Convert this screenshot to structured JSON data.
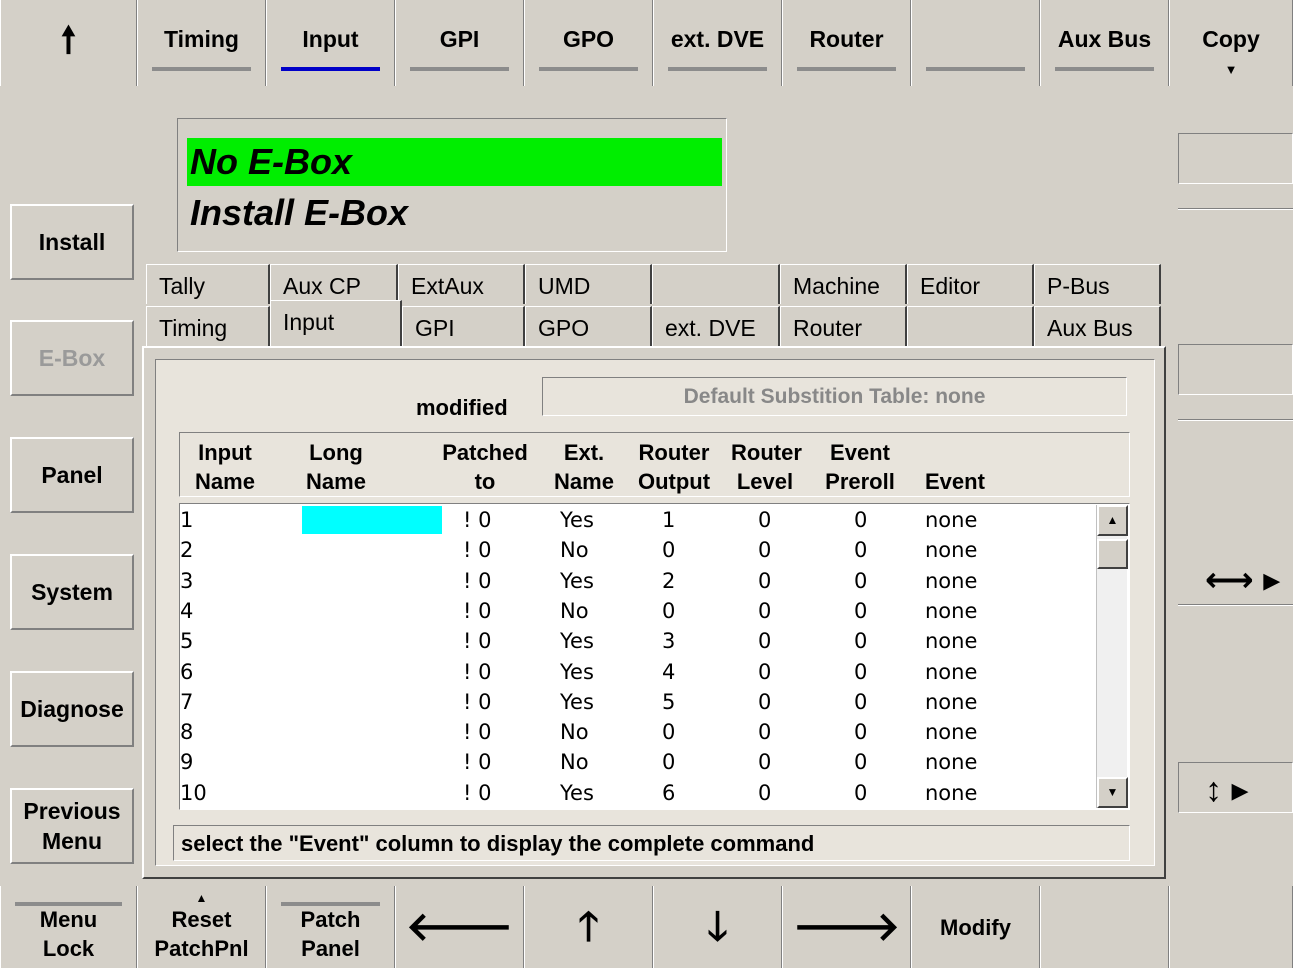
{
  "top_nav": {
    "up_icon": "up-arrow",
    "items": [
      {
        "label": "Timing",
        "active": false
      },
      {
        "label": "Input",
        "active": true
      },
      {
        "label": "GPI",
        "active": false
      },
      {
        "label": "GPO",
        "active": false
      },
      {
        "label": "ext. DVE",
        "active": false
      },
      {
        "label": "Router",
        "active": false
      },
      {
        "label": "",
        "active": false
      },
      {
        "label": "Aux Bus",
        "active": false
      }
    ],
    "copy_label": "Copy"
  },
  "left_menu": {
    "install": "Install",
    "ebox": "E-Box",
    "panel": "Panel",
    "system": "System",
    "diagnose": "Diagnose",
    "previous_line1": "Previous",
    "previous_line2": "Menu"
  },
  "ebox_status": {
    "line1": "No E-Box",
    "line2": "Install E-Box",
    "highlight_color": "#00ee00"
  },
  "tabs_row1": [
    "Tally",
    "Aux CP",
    "ExtAux",
    "UMD",
    "",
    "Machine",
    "Editor",
    "P-Bus"
  ],
  "tabs_row2": [
    "Timing",
    "Input",
    "GPI",
    "GPO",
    "ext. DVE",
    "Router",
    "",
    "Aux Bus"
  ],
  "panel": {
    "modified": "modified",
    "default_table": "Default Substition Table: none",
    "headers": {
      "input_name": [
        "Input",
        "Name"
      ],
      "long_name": [
        "Long",
        "Name"
      ],
      "patched_to": [
        "Patched",
        "to"
      ],
      "ext_name": [
        "Ext.",
        "Name"
      ],
      "router_output": [
        "Router",
        "Output"
      ],
      "router_level": [
        "Router",
        "Level"
      ],
      "event_preroll": [
        "Event",
        "Preroll"
      ],
      "event": [
        "",
        "Event"
      ]
    },
    "rows": [
      {
        "input": "1",
        "long": "",
        "patched": "! 0",
        "ext": "Yes",
        "out": "1",
        "level": "0",
        "preroll": "0",
        "event": "none"
      },
      {
        "input": "2",
        "long": "",
        "patched": "! 0",
        "ext": "No",
        "out": "0",
        "level": "0",
        "preroll": "0",
        "event": "none"
      },
      {
        "input": "3",
        "long": "",
        "patched": "! 0",
        "ext": "Yes",
        "out": "2",
        "level": "0",
        "preroll": "0",
        "event": "none"
      },
      {
        "input": "4",
        "long": "",
        "patched": "! 0",
        "ext": "No",
        "out": "0",
        "level": "0",
        "preroll": "0",
        "event": "none"
      },
      {
        "input": "5",
        "long": "",
        "patched": "! 0",
        "ext": "Yes",
        "out": "3",
        "level": "0",
        "preroll": "0",
        "event": "none"
      },
      {
        "input": "6",
        "long": "",
        "patched": "! 0",
        "ext": "Yes",
        "out": "4",
        "level": "0",
        "preroll": "0",
        "event": "none"
      },
      {
        "input": "7",
        "long": "",
        "patched": "! 0",
        "ext": "Yes",
        "out": "5",
        "level": "0",
        "preroll": "0",
        "event": "none"
      },
      {
        "input": "8",
        "long": "",
        "patched": "! 0",
        "ext": "No",
        "out": "0",
        "level": "0",
        "preroll": "0",
        "event": "none"
      },
      {
        "input": "9",
        "long": "",
        "patched": "! 0",
        "ext": "No",
        "out": "0",
        "level": "0",
        "preroll": "0",
        "event": "none"
      },
      {
        "input": "10",
        "long": "",
        "patched": "! 0",
        "ext": "Yes",
        "out": "6",
        "level": "0",
        "preroll": "0",
        "event": "none"
      }
    ],
    "selected_cell_color": "#00ffff",
    "status": "select the \"Event\" column to display the complete command"
  },
  "bottom_bar": {
    "menu_lock": [
      "Menu",
      "Lock"
    ],
    "reset": [
      "Reset",
      "PatchPnl"
    ],
    "patch": [
      "Patch",
      "Panel"
    ],
    "left_icon": "left-arrow",
    "up_icon": "up-arrow",
    "down_icon": "down-arrow",
    "right_icon": "right-arrow",
    "modify": "Modify"
  },
  "right_column": {
    "horizontal_icon": "horizontal-resize",
    "vertical_icon": "vertical-resize"
  }
}
